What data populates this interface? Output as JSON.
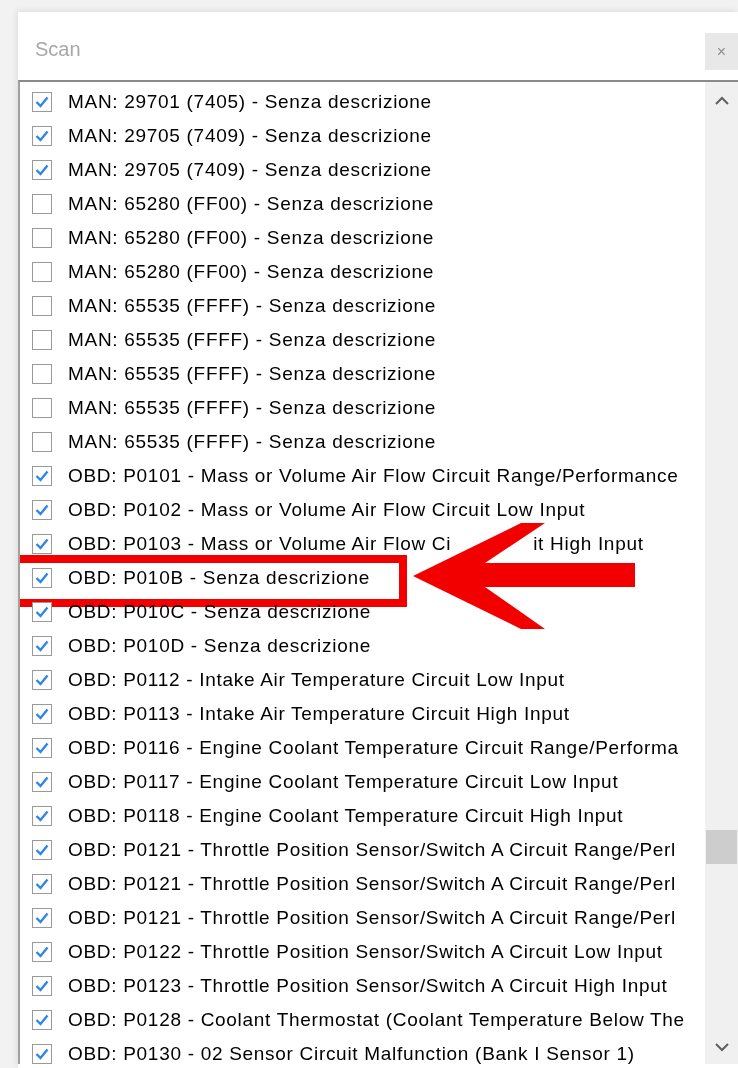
{
  "window": {
    "title": "Scan",
    "close_label": "×"
  },
  "items": [
    {
      "label": "MAN: 29701 (7405) - Senza descrizione",
      "checked": true,
      "highlighted": false
    },
    {
      "label": "MAN: 29705 (7409) - Senza descrizione",
      "checked": true,
      "highlighted": false
    },
    {
      "label": "MAN: 29705 (7409) - Senza descrizione",
      "checked": true,
      "highlighted": false
    },
    {
      "label": "MAN: 65280 (FF00) - Senza descrizione",
      "checked": false,
      "highlighted": false
    },
    {
      "label": "MAN: 65280 (FF00) - Senza descrizione",
      "checked": false,
      "highlighted": false
    },
    {
      "label": "MAN: 65280 (FF00) - Senza descrizione",
      "checked": false,
      "highlighted": false
    },
    {
      "label": "MAN: 65535 (FFFF) - Senza descrizione",
      "checked": false,
      "highlighted": false
    },
    {
      "label": "MAN: 65535 (FFFF) - Senza descrizione",
      "checked": false,
      "highlighted": false
    },
    {
      "label": "MAN: 65535 (FFFF) - Senza descrizione",
      "checked": false,
      "highlighted": false
    },
    {
      "label": "MAN: 65535 (FFFF) - Senza descrizione",
      "checked": false,
      "highlighted": false
    },
    {
      "label": "MAN: 65535 (FFFF) - Senza descrizione",
      "checked": false,
      "highlighted": false
    },
    {
      "label": "OBD: P0101 - Mass or Volume Air Flow Circuit Range/Performance",
      "checked": true,
      "highlighted": false
    },
    {
      "label": "OBD: P0102 - Mass or Volume Air Flow Circuit Low Input",
      "checked": true,
      "highlighted": false
    },
    {
      "label": "OBD: P0103 - Mass or Volume Air Flow Ci",
      "label_tail": "it High Input",
      "checked": true,
      "highlighted": false
    },
    {
      "label": "OBD: P010B - Senza descrizione",
      "checked": true,
      "highlighted": true
    },
    {
      "label": "OBD: P010C - Senza descrizione",
      "checked": true,
      "highlighted": false
    },
    {
      "label": "OBD: P010D - Senza descrizione",
      "checked": true,
      "highlighted": false
    },
    {
      "label": "OBD: P0112 - Intake Air Temperature Circuit Low Input",
      "checked": true,
      "highlighted": false
    },
    {
      "label": "OBD: P0113 - Intake Air Temperature Circuit High Input",
      "checked": true,
      "highlighted": false
    },
    {
      "label": "OBD: P0116 - Engine Coolant Temperature Circuit Range/Performa",
      "checked": true,
      "highlighted": false
    },
    {
      "label": "OBD: P0117 - Engine Coolant Temperature Circuit Low Input",
      "checked": true,
      "highlighted": false
    },
    {
      "label": "OBD: P0118 - Engine Coolant Temperature Circuit High Input",
      "checked": true,
      "highlighted": false
    },
    {
      "label": "OBD: P0121 - Throttle Position Sensor/Switch A Circuit Range/Perl",
      "checked": true,
      "highlighted": false
    },
    {
      "label": "OBD: P0121 - Throttle Position Sensor/Switch A Circuit Range/Perl",
      "checked": true,
      "highlighted": false
    },
    {
      "label": "OBD: P0121 - Throttle Position Sensor/Switch A Circuit Range/Perl",
      "checked": true,
      "highlighted": false
    },
    {
      "label": "OBD: P0122 - Throttle Position Sensor/Switch A Circuit Low Input",
      "checked": true,
      "highlighted": false
    },
    {
      "label": "OBD: P0123 - Throttle Position Sensor/Switch A Circuit High Input",
      "checked": true,
      "highlighted": false
    },
    {
      "label": "OBD: P0128 - Coolant Thermostat (Coolant Temperature Below The",
      "checked": true,
      "highlighted": false
    },
    {
      "label": "OBD: P0130 - 02 Sensor Circuit Malfunction (Bank I Sensor 1)",
      "checked": true,
      "highlighted": false
    }
  ]
}
